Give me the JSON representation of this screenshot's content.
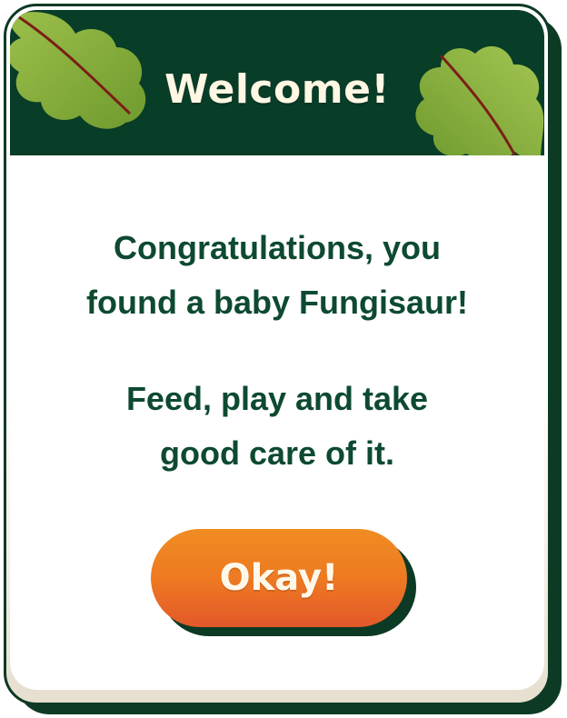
{
  "dialog": {
    "title": "Welcome!",
    "message_1": [
      "Congratulations, you",
      "found a baby Fungisaur!"
    ],
    "message_2": [
      "Feed, play and take",
      "good care of it."
    ],
    "ok_label": "Okay!"
  },
  "icons": {
    "header_left": "leaf-icon",
    "header_right": "leaf-icon"
  },
  "colors": {
    "header_bg": "#083d28",
    "title_text": "#fff6e3",
    "body_text": "#0d4a30",
    "button_top": "#f08c22",
    "button_bottom": "#e3582a",
    "leaf_green": "#8fb33e",
    "leaf_vein": "#7a1f16"
  }
}
